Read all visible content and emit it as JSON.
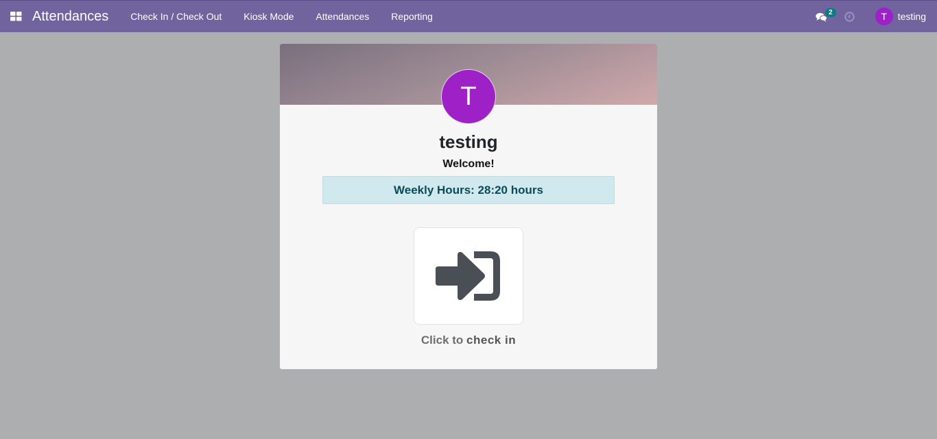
{
  "navbar": {
    "app_title": "Attendances",
    "menu": [
      {
        "label": "Check In / Check Out"
      },
      {
        "label": "Kiosk Mode"
      },
      {
        "label": "Attendances"
      },
      {
        "label": "Reporting"
      }
    ],
    "messages_count": "2",
    "user": {
      "initial": "T",
      "name": "testing"
    }
  },
  "employee": {
    "initial": "T",
    "name": "testing",
    "welcome": "Welcome!",
    "weekly_hours": "Weekly Hours: 28:20 hours"
  },
  "checkin": {
    "prefix": "Click to",
    "action": "check in"
  },
  "colors": {
    "navbar": "#71639e",
    "avatar": "#9e20c7",
    "info_box": "#cfe9ee",
    "badge": "#017e84"
  }
}
